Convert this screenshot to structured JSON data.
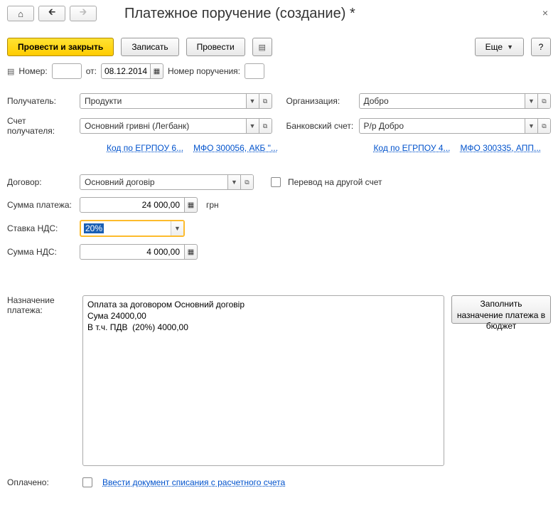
{
  "header": {
    "title": "Платежное поручение (создание) *"
  },
  "toolbar": {
    "post_close": "Провести и закрыть",
    "save": "Записать",
    "post": "Провести",
    "more": "Еще",
    "help": "?"
  },
  "doc": {
    "number_label": "Номер:",
    "number_value": "",
    "date_label": "от:",
    "date_value": "08.12.2014",
    "order_number_label": "Номер поручения:",
    "order_number_value": ""
  },
  "recipient": {
    "label": "Получатель:",
    "value": "Продукти",
    "account_label": "Счет получателя:",
    "account_value": "Основний гривні (Легбанк)",
    "link1": "Код по ЕГРПОУ 6...",
    "link2": "МФО 300056, АКБ \"..."
  },
  "org": {
    "label": "Организация:",
    "value": "Добро",
    "bank_label": "Банковский счет:",
    "bank_value": "Р/р Добро",
    "link1": "Код по ЕГРПОУ 4...",
    "link2": "МФО 300335, АПП..."
  },
  "contract": {
    "label": "Договор:",
    "value": "Основний договір",
    "transfer_label": "Перевод на другой счет"
  },
  "payment": {
    "amount_label": "Сумма платежа:",
    "amount_value": "24 000,00",
    "currency": "грн",
    "vat_rate_label": "Ставка НДС:",
    "vat_rate_value": "20%",
    "vat_amount_label": "Сумма НДС:",
    "vat_amount_value": "4 000,00"
  },
  "purpose": {
    "label": "Назначение платежа:",
    "text": "Оплата за договором Основний договір\nСума 24000,00\nВ т.ч. ПДВ  (20%) 4000,00",
    "fill_button": "Заполнить назначение платежа в бюджет"
  },
  "paid": {
    "label": "Оплачено:",
    "link": "Ввести документ списания с расчетного счета"
  }
}
